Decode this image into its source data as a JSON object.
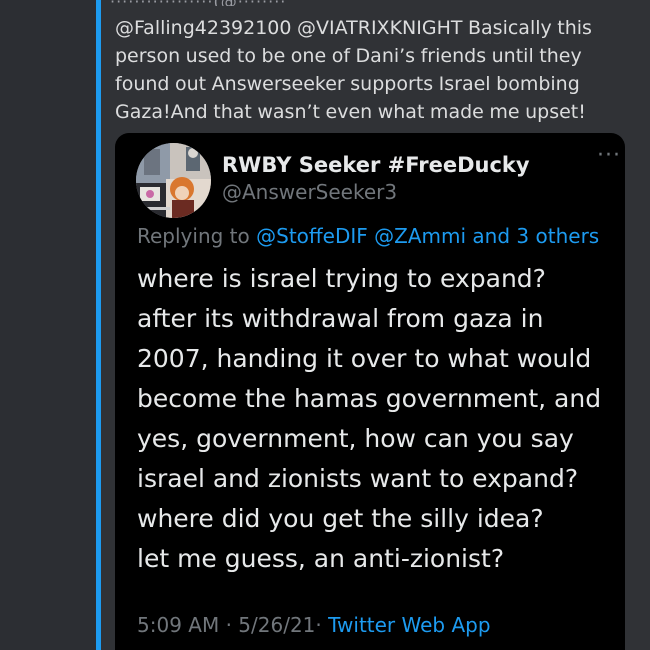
{
  "top_partial": "·················(@········",
  "message": {
    "text": "@Falling42392100 @VIATRIXKNIGHT Basically this person used to be one of Dani’s friends until they found out Answerseeker supports Israel bombing Gaza!And that wasn’t even what made me upset!"
  },
  "tweet": {
    "display_name": "RWBY Seeker #FreeDucky",
    "handle": "@AnswerSeeker3",
    "more_glyph": "···",
    "replying_prefix": "Replying to",
    "replying_to_1": "@StoffeDIF",
    "replying_to_2": "@ZAmmi",
    "replying_and": "and",
    "replying_others": "3 others",
    "body": "where is israel trying to expand?\nafter its withdrawal from gaza in\n2007, handing it over to what would\nbecome the hamas government, and\nyes, government, how can you say\nisrael and zionists want to expand?\nwhere did you get the silly idea?\nlet me guess, an anti-zionist?",
    "time": "5:09 AM",
    "separator": "·",
    "date": "5/26/21",
    "source_app": "Twitter Web App"
  },
  "colors": {
    "accent": "#1d9bf0",
    "background": "#303236",
    "card": "#000000",
    "text_primary": "#e7e9ea",
    "text_muted": "#71767b"
  }
}
